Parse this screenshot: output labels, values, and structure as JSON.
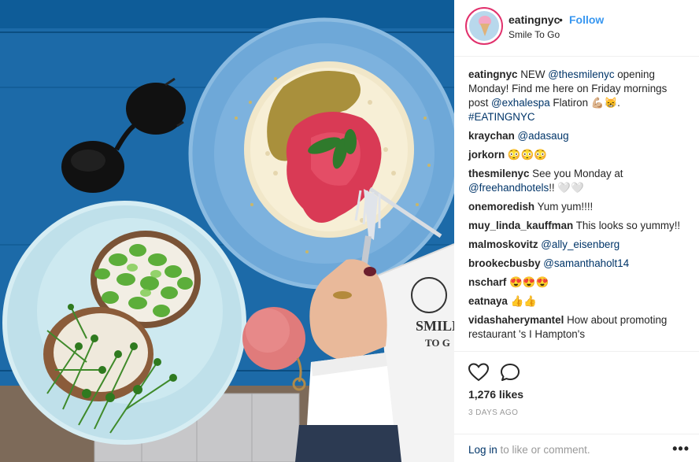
{
  "post": {
    "username": "eatingnyc",
    "separator": "•",
    "follow_label": "Follow",
    "location": "Smile To Go",
    "avatar_icon": "ice-cream-avatar"
  },
  "caption": {
    "username": "eatingnyc",
    "parts": [
      "NEW ",
      "@thesmilenyc",
      " opening Monday! Find me here on Friday mornings post ",
      "@exhalespa",
      " Flatiron 💪🏼😸. ",
      "#EATINGNYC"
    ]
  },
  "comments": [
    {
      "user": "kraychan",
      "text": "",
      "mention": "@adasaug",
      "after": ""
    },
    {
      "user": "jorkorn",
      "text": "😳😳😳",
      "mention": "",
      "after": ""
    },
    {
      "user": "thesmilenyc",
      "text": "See you Monday at ",
      "mention": "@freehandhotels",
      "after": "!! 🤍🤍"
    },
    {
      "user": "onemoredish",
      "text": "Yum yum!!!!",
      "mention": "",
      "after": ""
    },
    {
      "user": "muy_linda_kauffman",
      "text": "This looks so yummy!!",
      "mention": "",
      "after": ""
    },
    {
      "user": "malmoskovitz",
      "text": "",
      "mention": "@ally_eisenberg",
      "after": ""
    },
    {
      "user": "brookecbusby",
      "text": "",
      "mention": "@samanthaholt14",
      "after": ""
    },
    {
      "user": "nscharf",
      "text": "😍😍😍",
      "mention": "",
      "after": ""
    },
    {
      "user": "eatnaya",
      "text": "👍👍",
      "mention": "",
      "after": ""
    },
    {
      "user": "vidashaherymantel",
      "text": "How about promoting restaurant 's I Hampton's",
      "mention": "",
      "after": ""
    }
  ],
  "actions": {
    "like_icon": "heart-icon",
    "comment_icon": "comment-icon",
    "likes": "1,276 likes",
    "time_ago": "3 DAYS AGO",
    "login_link": "Log in",
    "login_rest": " to like or comment.",
    "more_label": "•••"
  },
  "photo": {
    "bag_text_1": "SMILE",
    "bag_text_2": "TO G",
    "colors": {
      "table": "#1f6fae",
      "plate_left": "#bfe0ea",
      "plate_right": "#6ea8d8",
      "pompom": "#e07b7b"
    }
  }
}
